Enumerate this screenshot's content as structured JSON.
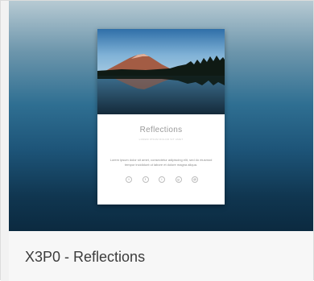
{
  "theme": {
    "title": "X3P0 - Reflections"
  },
  "preview_card": {
    "title": "Reflections",
    "subtitle": "LOREM IPSUM DOLOR SIT AMET",
    "body": "Lorem ipsum dolor sit amet, consectetur adipiscing elit, sed do eiusmod tempor incididunt ut labore et dolore magna aliqua.",
    "social_icons": [
      {
        "name": "twitter-icon",
        "glyph": "t"
      },
      {
        "name": "facebook-icon",
        "glyph": "f"
      },
      {
        "name": "instagram-icon",
        "glyph": "i"
      },
      {
        "name": "github-icon",
        "glyph": "g"
      },
      {
        "name": "email-icon",
        "glyph": "@"
      }
    ]
  },
  "colors": {
    "gradient_top": "#b7cad3",
    "gradient_bottom": "#0b2a40",
    "footer_bg": "#f7f7f7",
    "title_text": "#3c3c3c"
  }
}
